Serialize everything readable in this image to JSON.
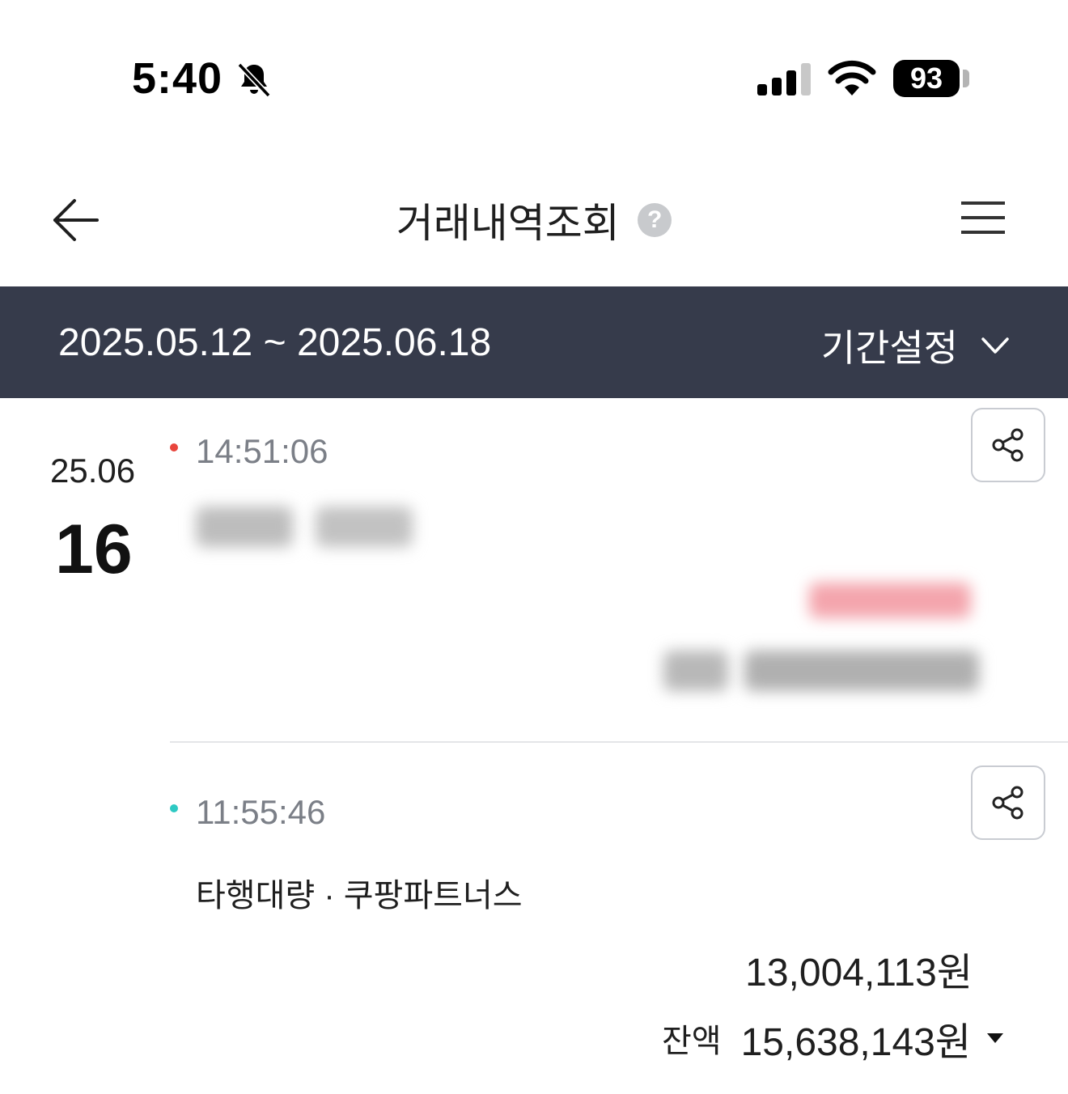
{
  "status_bar": {
    "time": "5:40",
    "battery": "93"
  },
  "header": {
    "title": "거래내역조회",
    "help_glyph": "?"
  },
  "period": {
    "range": "2025.05.12 ~ 2025.06.18",
    "setting_label": "기간설정"
  },
  "date_group": {
    "year_month": "25.06",
    "day": "16"
  },
  "transactions": [
    {
      "time": "14:51:06",
      "type": "withdrawal",
      "dot_color": "#e8453c",
      "description": "",
      "amount": "",
      "balance_label": "",
      "balance": "",
      "blurred": true
    },
    {
      "time": "11:55:46",
      "type": "deposit",
      "dot_color": "#2ec9c3",
      "description": "타행대량 · 쿠팡파트너스",
      "amount": "13,004,113원",
      "balance_label": "잔액",
      "balance": "15,638,143원",
      "blurred": false
    }
  ]
}
